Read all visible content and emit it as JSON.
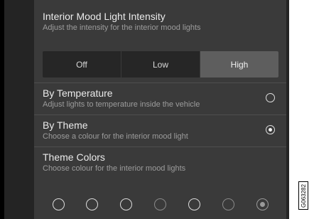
{
  "intensity": {
    "title": "Interior Mood Light Intensity",
    "subtitle": "Adjust the intensity for the interior mood lights",
    "options": [
      "Off",
      "Low",
      "High"
    ],
    "selected": "High"
  },
  "by_temperature": {
    "title": "By Temperature",
    "subtitle": "Adjust lights to temperature inside the vehicle",
    "selected": false
  },
  "by_theme": {
    "title": "By Theme",
    "subtitle": "Choose a colour for the interior mood light",
    "selected": true
  },
  "theme_colors": {
    "title": "Theme Colors",
    "subtitle": "Choose colour for the interior mood lights",
    "swatch_count": 7,
    "selected_index": 6
  },
  "figure_code": "G063282",
  "colors": {
    "panel": "#3a3a3a",
    "frame": "#242424",
    "segment_active": "#5e5e5e",
    "text": "#ebebeb",
    "subtext": "#9c9c9c"
  }
}
